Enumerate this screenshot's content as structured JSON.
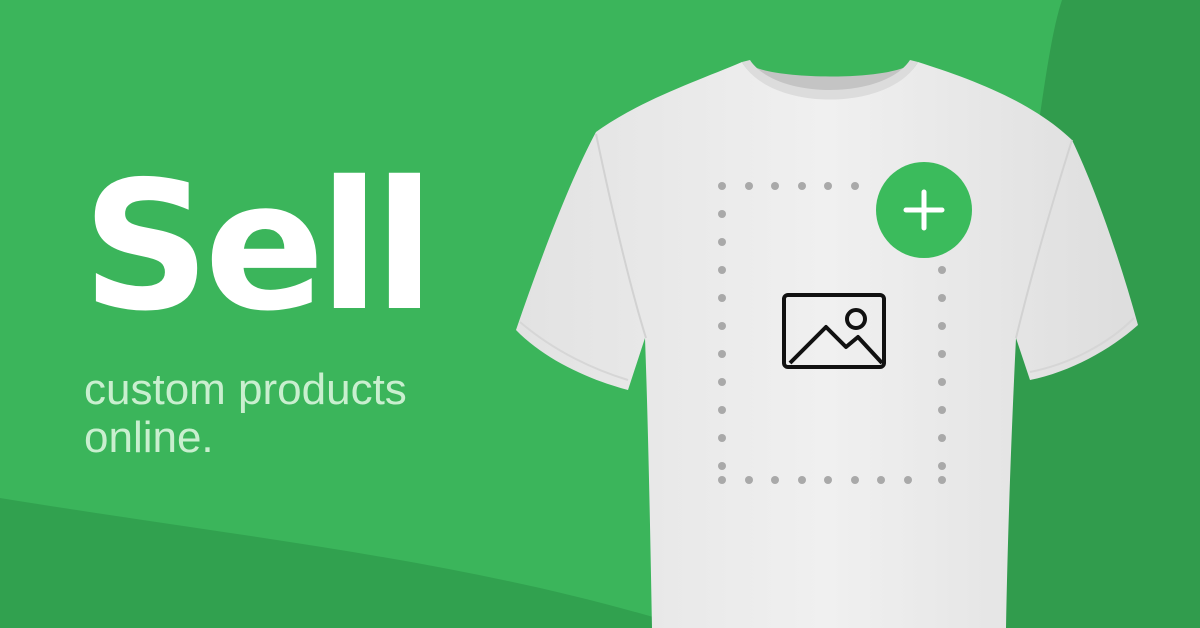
{
  "hero": {
    "headline": "Sell",
    "subline": "custom products online."
  },
  "product": {
    "item": "t-shirt",
    "placeholder_icon": "image-icon",
    "add_icon": "plus-icon"
  },
  "colors": {
    "background": "#3bb55b",
    "background_dark": "#319c4d",
    "headline": "#ffffff",
    "subline": "#c9efcf",
    "shirt": "#ebebeb",
    "dots": "#a9a9a9",
    "accent": "#3bbb5c",
    "icon": "#111111"
  }
}
